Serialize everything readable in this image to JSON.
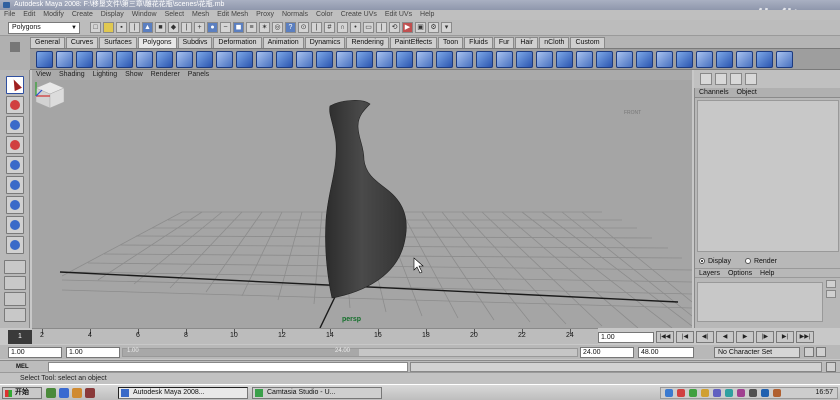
{
  "window": {
    "title": "Autodesk Maya 2008: F:\\移垦文件\\第三章\\雕花花瓶\\scenes\\花瓶.mb"
  },
  "watermark": "佐华",
  "menubar": [
    "File",
    "Edit",
    "Modify",
    "Create",
    "Display",
    "Window",
    "Select",
    "Mesh",
    "Edit Mesh",
    "Proxy",
    "Normals",
    "Color",
    "Create UVs",
    "Edit UVs",
    "Help"
  ],
  "status_line": {
    "mode": "Polygons"
  },
  "shelf_tabs": [
    {
      "label": "General",
      "active": false
    },
    {
      "label": "Curves",
      "active": false
    },
    {
      "label": "Surfaces",
      "active": false
    },
    {
      "label": "Polygons",
      "active": true
    },
    {
      "label": "Subdivs",
      "active": false
    },
    {
      "label": "Deformation",
      "active": false
    },
    {
      "label": "Animation",
      "active": false
    },
    {
      "label": "Dynamics",
      "active": false
    },
    {
      "label": "Rendering",
      "active": false
    },
    {
      "label": "PaintEffects",
      "active": false
    },
    {
      "label": "Toon",
      "active": false
    },
    {
      "label": "Fluids",
      "active": false
    },
    {
      "label": "Fur",
      "active": false
    },
    {
      "label": "Hair",
      "active": false
    },
    {
      "label": "nCloth",
      "active": false
    },
    {
      "label": "Custom",
      "active": false
    }
  ],
  "panel_menu": [
    "View",
    "Shading",
    "Lighting",
    "Show",
    "Renderer",
    "Panels"
  ],
  "viewport": {
    "camera": "persp",
    "view_cube_label": "FRONT",
    "background": "#a5a5a5"
  },
  "channel_box": {
    "menu": [
      "Channels",
      "Object"
    ]
  },
  "layer_editor": {
    "display_label": "Display",
    "render_label": "Render",
    "menu": [
      "Layers",
      "Options",
      "Help"
    ]
  },
  "time_slider": {
    "ticks": [
      "2",
      "4",
      "6",
      "8",
      "10",
      "12",
      "14",
      "16",
      "18",
      "20",
      "22",
      "24"
    ],
    "current_frame": "1.00",
    "marker": "1"
  },
  "range_slider": {
    "start_time": "1.00",
    "start_range": "1.00",
    "range_start_label": "1.00",
    "range_end_label": "24.00",
    "end_range": "24.00",
    "end_time": "48.00",
    "character_set": "No Character Set"
  },
  "command_line": {
    "label": "MEL"
  },
  "help_line": "Select Tool: select an object",
  "taskbar": {
    "start": "开始",
    "tasks": [
      {
        "label": "Autodesk Maya 2008...",
        "active": true
      },
      {
        "label": "Camtasia Studio - U...",
        "active": false
      }
    ],
    "clock": "16:57"
  }
}
